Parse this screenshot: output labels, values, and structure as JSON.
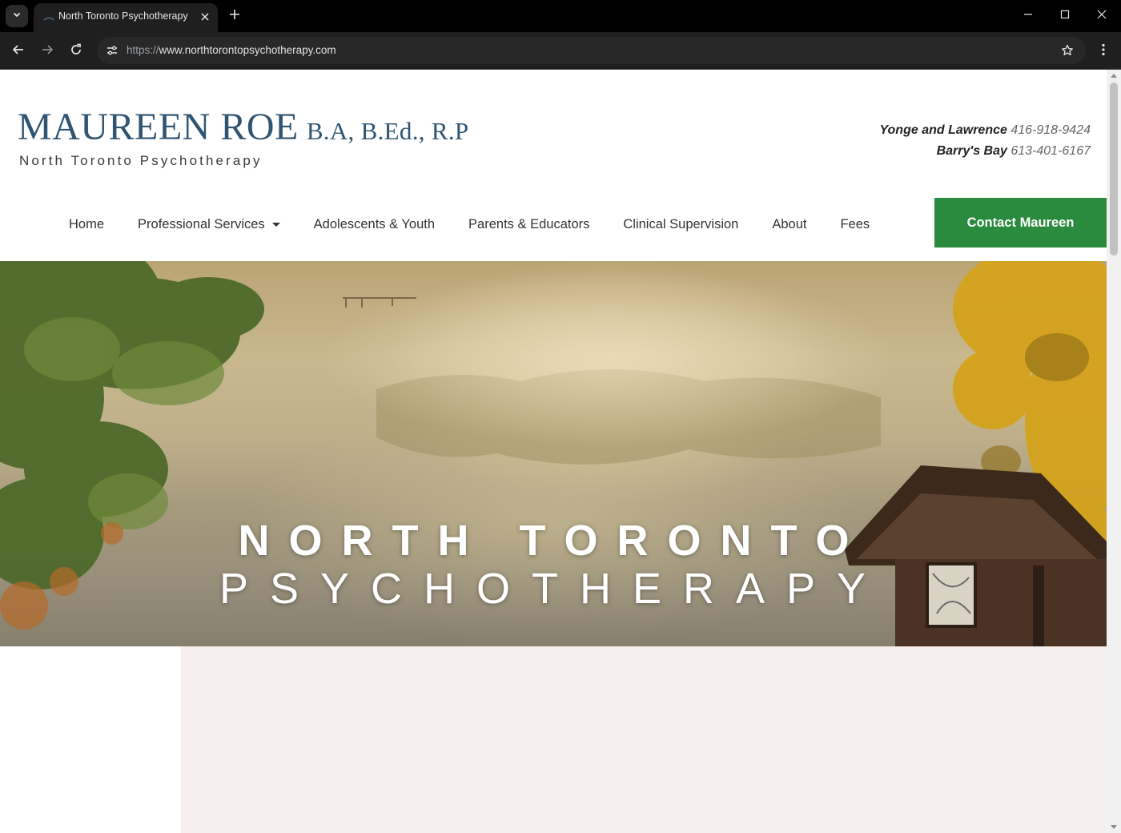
{
  "browser": {
    "tab_title": "North Toronto Psychotherapy",
    "url_scheme": "https://",
    "url_host": "www.northtorontopsychotherapy.com"
  },
  "header": {
    "logo_name": "MAUREEN ROE",
    "logo_credentials": "B.A, B.Ed., R.P",
    "logo_tagline": "North Toronto Psychotherapy",
    "locations": [
      {
        "name": "Yonge and Lawrence",
        "phone": "416-918-9424"
      },
      {
        "name": "Barry's Bay",
        "phone": "613-401-6167"
      }
    ]
  },
  "nav": {
    "items": [
      {
        "label": "Home"
      },
      {
        "label": "Professional Services"
      },
      {
        "label": "Adolescents & Youth"
      },
      {
        "label": "Parents & Educators"
      },
      {
        "label": "Clinical Supervision"
      },
      {
        "label": "About"
      },
      {
        "label": "Fees"
      }
    ],
    "cta_label": "Contact Maureen"
  },
  "hero": {
    "title_line1": "NORTH TORONTO",
    "title_line2": "PSYCHOTHERAPY"
  },
  "colors": {
    "brand_blue": "#2f5572",
    "cta_green": "#2a8a3e",
    "panel_pink": "#f6efed"
  }
}
